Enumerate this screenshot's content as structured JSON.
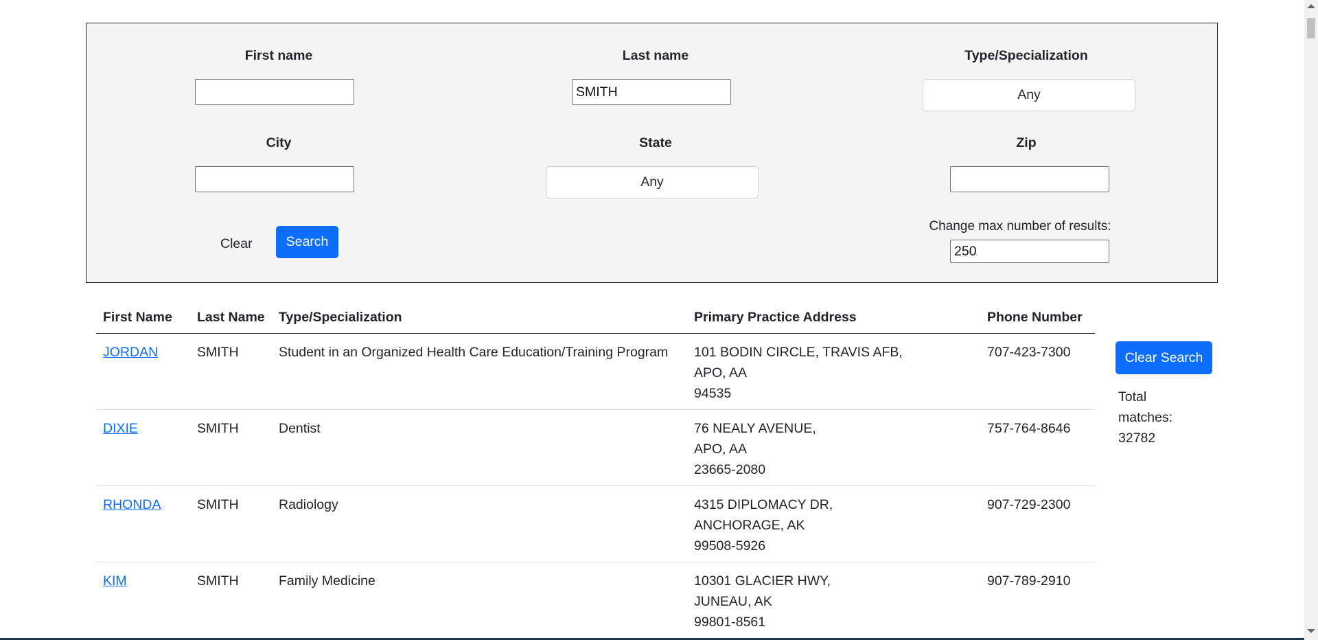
{
  "search": {
    "first_name_label": "First name",
    "first_name_value": "",
    "last_name_label": "Last name",
    "last_name_value": "SMITH",
    "type_label": "Type/Specialization",
    "type_value": "Any",
    "city_label": "City",
    "city_value": "",
    "state_label": "State",
    "state_value": "Any",
    "zip_label": "Zip",
    "zip_value": "",
    "clear_label": "Clear",
    "search_label": "Search",
    "max_results_label": "Change max number of results:",
    "max_results_value": "250"
  },
  "table": {
    "headers": [
      "First Name",
      "Last Name",
      "Type/Specialization",
      "Primary Practice Address",
      "Phone Number"
    ],
    "rows": [
      {
        "first": "JORDAN",
        "last": "SMITH",
        "type": "Student in an Organized Health Care Education/Training Program",
        "addr1": "101 BODIN CIRCLE, TRAVIS AFB,",
        "addr2": "APO, AA",
        "addr3": "94535",
        "phone": "707-423-7300"
      },
      {
        "first": "DIXIE",
        "last": "SMITH",
        "type": "Dentist",
        "addr1": "76 NEALY AVENUE,",
        "addr2": "APO, AA",
        "addr3": "23665-2080",
        "phone": "757-764-8646"
      },
      {
        "first": "RHONDA",
        "last": "SMITH",
        "type": "Radiology",
        "addr1": "4315 DIPLOMACY DR,",
        "addr2": "ANCHORAGE, AK",
        "addr3": "99508-5926",
        "phone": "907-729-2300"
      },
      {
        "first": "KIM",
        "last": "SMITH",
        "type": "Family Medicine",
        "addr1": "10301 GLACIER HWY,",
        "addr2": "JUNEAU, AK",
        "addr3": "99801-8561",
        "phone": "907-789-2910"
      }
    ]
  },
  "side": {
    "clear_search_label": "Clear Search",
    "total_label": "Total matches:",
    "total_value": "32782"
  },
  "colors": {
    "primary": "#0d6efd",
    "panel_bg": "#f4f4f4",
    "link": "#0d6efd"
  }
}
